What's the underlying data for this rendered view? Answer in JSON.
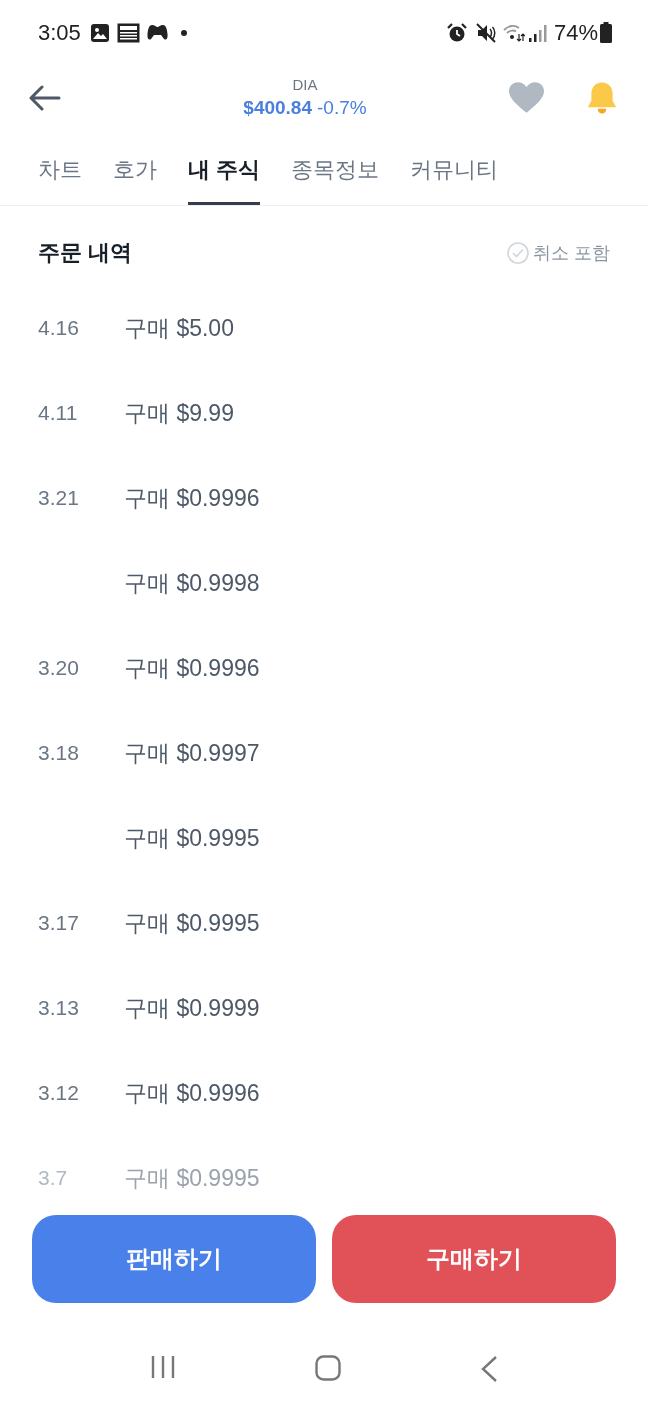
{
  "status_bar": {
    "time": "3:05",
    "battery": "74%"
  },
  "header": {
    "symbol": "DIA",
    "price": "$400.84",
    "change": "-0.7%",
    "favorite": {
      "on": false
    },
    "alert": {
      "on": true
    }
  },
  "tabs": [
    {
      "label": "차트",
      "selected": false
    },
    {
      "label": "호가",
      "selected": false
    },
    {
      "label": "내 주식",
      "selected": true
    },
    {
      "label": "종목정보",
      "selected": false
    },
    {
      "label": "커뮤니티",
      "selected": false
    }
  ],
  "section": {
    "title": "주문 내역",
    "filter": {
      "label": "취소 포함",
      "checked": false
    }
  },
  "orders": [
    {
      "date": "4.16",
      "text": "구매 $5.00",
      "faded": false
    },
    {
      "date": "4.11",
      "text": "구매 $9.99",
      "faded": false
    },
    {
      "date": "3.21",
      "text": "구매 $0.9996",
      "faded": false
    },
    {
      "text": "구매 $0.9998",
      "faded": false
    },
    {
      "date": "3.20",
      "text": "구매 $0.9996",
      "faded": false
    },
    {
      "date": "3.18",
      "text": "구매 $0.9997",
      "faded": false
    },
    {
      "text": "구매 $0.9995",
      "faded": false
    },
    {
      "date": "3.17",
      "text": "구매 $0.9995",
      "faded": false
    },
    {
      "date": "3.13",
      "text": "구매 $0.9999",
      "faded": false
    },
    {
      "date": "3.12",
      "text": "구매 $0.9996",
      "faded": false
    },
    {
      "date": "3.7",
      "text": "구매 $0.9995",
      "faded": true
    }
  ],
  "buttons": [
    {
      "kind": "sell",
      "label": "판매하기"
    },
    {
      "kind": "buy",
      "label": "구매하기"
    }
  ]
}
